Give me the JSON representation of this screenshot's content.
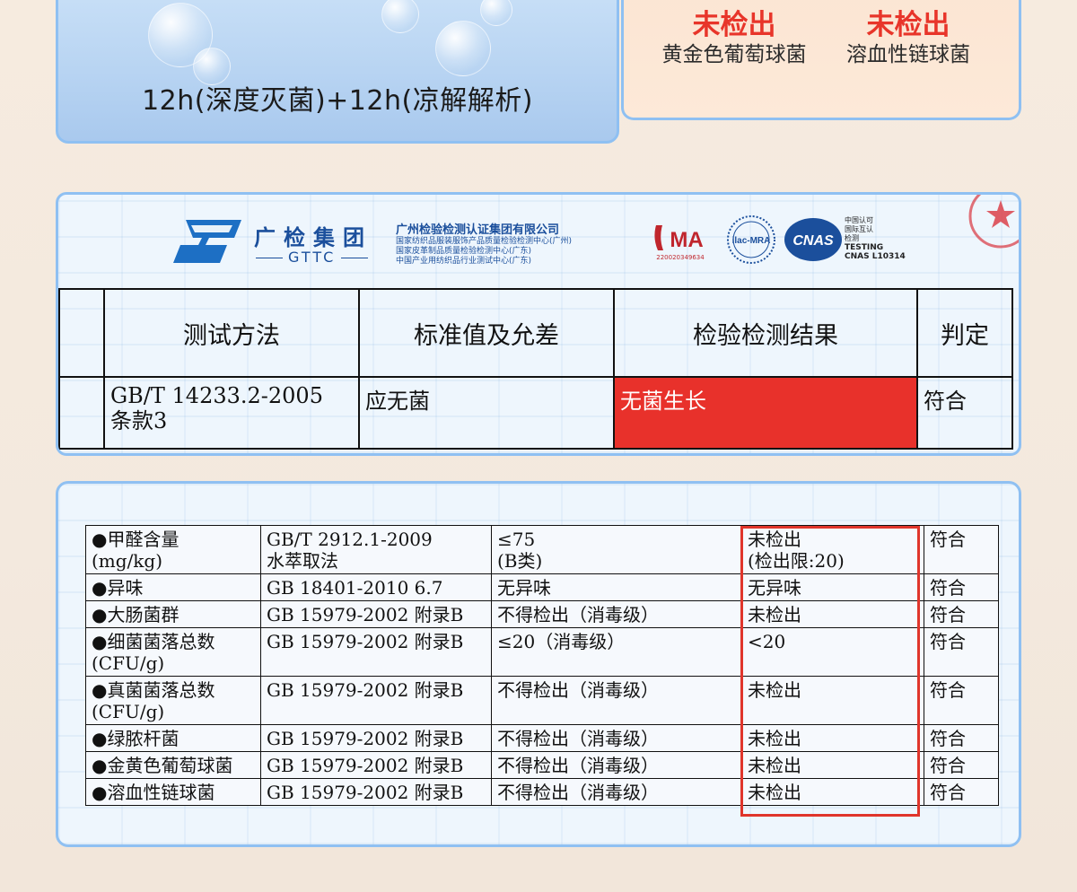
{
  "top_left": {
    "caption": "12h(深度灭菌)+12h(凉解解析)"
  },
  "top_right": {
    "items": [
      {
        "status": "未检出",
        "name": "黄金色葡萄球菌"
      },
      {
        "status": "未检出",
        "name": "溶血性链球菌"
      }
    ]
  },
  "certificate": {
    "group_name": "广检集团",
    "group_abbr": "GTTC",
    "company_name": "广州检验检测认证集团有限公司",
    "company_subs": [
      "国家纺织品服装服饰产品质量检验检测中心(广州)",
      "国家皮革制品质量检验检测中心(广东)",
      "中国产业用纺织品行业测试中心(广东)"
    ],
    "cma_label": "MA",
    "cma_number": "220020349634",
    "ilac_label": "ilac-MRA",
    "cnas_label": "CNAS",
    "cnas_text": [
      "中国认可",
      "国际互认",
      "检测"
    ],
    "cnas_testing": "TESTING",
    "cnas_code": "CNAS L10314",
    "headers": [
      "测试方法",
      "标准值及允差",
      "检验检测结果",
      "判定"
    ],
    "row": {
      "method_line1": "GB/T 14233.2-2005",
      "method_line2": "条款3",
      "standard": "应无菌",
      "result": "无菌生长",
      "verdict": "符合"
    },
    "colors": {
      "result_bg": "#e8312b",
      "brand": "#1b4f9c"
    }
  },
  "data_table": {
    "rows": [
      {
        "item": "●甲醛含量",
        "item2": "(mg/kg)",
        "method": "GB/T 2912.1-2009",
        "method2": "水萃取法",
        "standard": "≤75",
        "standard2": "(B类)",
        "result": "未检出",
        "result2": "(检出限:20)",
        "verdict": "符合"
      },
      {
        "item": "●异味",
        "item2": "",
        "method": "GB 18401-2010 6.7",
        "method2": "",
        "standard": "无异味",
        "standard2": "",
        "result": "无异味",
        "result2": "",
        "verdict": "符合"
      },
      {
        "item": "●大肠菌群",
        "item2": "",
        "method": "GB 15979-2002 附录B",
        "method2": "",
        "standard": "不得检出（消毒级）",
        "standard2": "",
        "result": "未检出",
        "result2": "",
        "verdict": "符合"
      },
      {
        "item": "●细菌菌落总数",
        "item2": "(CFU/g)",
        "method": "GB 15979-2002 附录B",
        "method2": "",
        "standard": "≤20（消毒级）",
        "standard2": "",
        "result": "<20",
        "result2": "",
        "verdict": "符合"
      },
      {
        "item": "●真菌菌落总数",
        "item2": "(CFU/g)",
        "method": "GB 15979-2002 附录B",
        "method2": "",
        "standard": "不得检出（消毒级）",
        "standard2": "",
        "result": "未检出",
        "result2": "",
        "verdict": "符合"
      },
      {
        "item": "●绿脓杆菌",
        "item2": "",
        "method": "GB 15979-2002 附录B",
        "method2": "",
        "standard": "不得检出（消毒级）",
        "standard2": "",
        "result": "未检出",
        "result2": "",
        "verdict": "符合"
      },
      {
        "item": "●金黄色葡萄球菌",
        "item2": "",
        "method": "GB 15979-2002 附录B",
        "method2": "",
        "standard": "不得检出（消毒级）",
        "standard2": "",
        "result": "未检出",
        "result2": "",
        "verdict": "符合"
      },
      {
        "item": "●溶血性链球菌",
        "item2": "",
        "method": "GB 15979-2002 附录B",
        "method2": "",
        "standard": "不得检出（消毒级）",
        "standard2": "",
        "result": "未检出",
        "result2": "",
        "verdict": "符合"
      }
    ],
    "highlight_color": "#e0352b"
  }
}
